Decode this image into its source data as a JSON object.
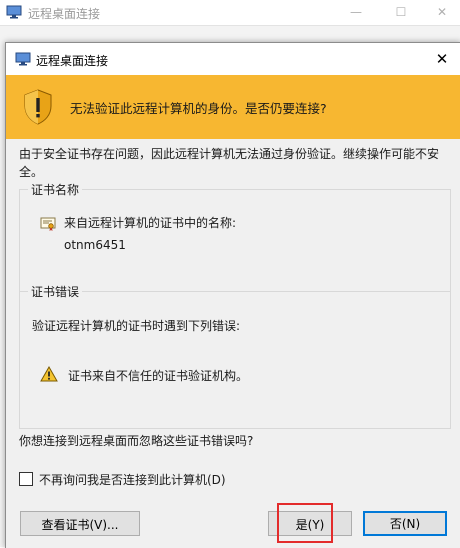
{
  "background_window": {
    "title": "远程桌面连接",
    "controls": {
      "minimize": "—",
      "maximize": "☐",
      "close": "✕"
    },
    "icon": "remote-desktop-icon"
  },
  "dialog": {
    "title": "远程桌面连接",
    "close": "✕",
    "icon": "remote-desktop-icon",
    "banner": {
      "icon": "warning-shield-icon",
      "text": "无法验证此远程计算机的身份。是否仍要连接?",
      "color": "#f7b731"
    },
    "description": "由于安全证书存在问题，因此远程计算机无法通过身份验证。继续操作可能不安全。",
    "cert_name_group": {
      "label": "证书名称",
      "icon": "certificate-icon",
      "line1": "来自远程计算机的证书中的名称:",
      "line2": "otnm6451"
    },
    "cert_error_group": {
      "label": "证书错误",
      "line1": "验证远程计算机的证书时遇到下列错误:",
      "icon": "warning-icon",
      "line2": "证书来自不信任的证书验证机构。"
    },
    "question": "你想连接到远程桌面而忽略这些证书错误吗?",
    "checkbox": {
      "label": "不再询问我是否连接到此计算机(D)",
      "checked": false
    },
    "buttons": {
      "view_cert": "查看证书(V)...",
      "yes": "是(Y)",
      "no": "否(N)"
    },
    "highlight_color": "#e32b2b",
    "accent_color": "#0078d7"
  }
}
